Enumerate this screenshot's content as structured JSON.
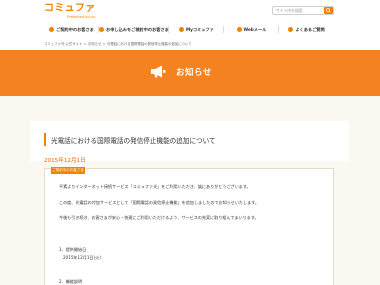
{
  "header": {
    "logo_main": "コミュファ",
    "logo_sub": "Presented by ctc",
    "search_placeholder": "サイト内を検索"
  },
  "nav": [
    {
      "label": "ご契約中のお客さま"
    },
    {
      "label": "お申し込みをご検討中のお客さま"
    },
    {
      "label": "Myコミュファ"
    },
    {
      "label": "Webメール"
    },
    {
      "label": "よくあるご質問"
    }
  ],
  "breadcrumb": "コミュファ光 公式サイト ＞ お知らせ ＞ 光電話における国際電話の発信停止機能の追加について",
  "banner": {
    "title": "お知らせ"
  },
  "article": {
    "title": "光電話における国際電話の発信停止機能の追加について",
    "date": "2015年12月1日",
    "tag": "ご契約中のお客さま",
    "p1": "平素よりインターネット接続サービス「コミュファ光」をご利用いただき、誠にありがとうございます。",
    "p2": "この度、光電話の付加サービスとして「国際電話の発信停止機能」を追加しましたのでお知らせいたします。",
    "p3": "今後も引き続き、お客さまが安心・快適にご利用いただけるよう、サービスの充実に取り組んでまいります。",
    "s1_head": "1．提供開始日",
    "s1_body": "2015年12月1日(火)",
    "s2_head": "2．機能説明"
  },
  "colors": {
    "accent": "#f08300",
    "banner": "#f58220",
    "bg": "#fbf7f1"
  }
}
